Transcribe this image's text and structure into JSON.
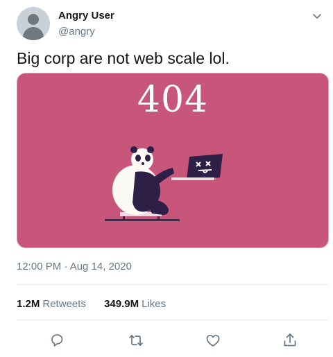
{
  "author": {
    "name": "Angry User",
    "handle": "@angry"
  },
  "tweet": {
    "text": "Big corp are not web scale lol.",
    "media_title": "404",
    "timestamp": "12:00 PM · Aug 14, 2020"
  },
  "stats": {
    "retweets_count": "1.2M",
    "retweets_label": "Retweets",
    "likes_count": "349.9M",
    "likes_label": "Likes"
  },
  "icons": {
    "menu": "chevron-down-icon",
    "reply": "reply-icon",
    "retweet": "retweet-icon",
    "like": "heart-icon",
    "share": "share-icon"
  },
  "colors": {
    "media_background": "#c8557a",
    "secondary_text": "#657786",
    "action_icon": "#657786"
  }
}
